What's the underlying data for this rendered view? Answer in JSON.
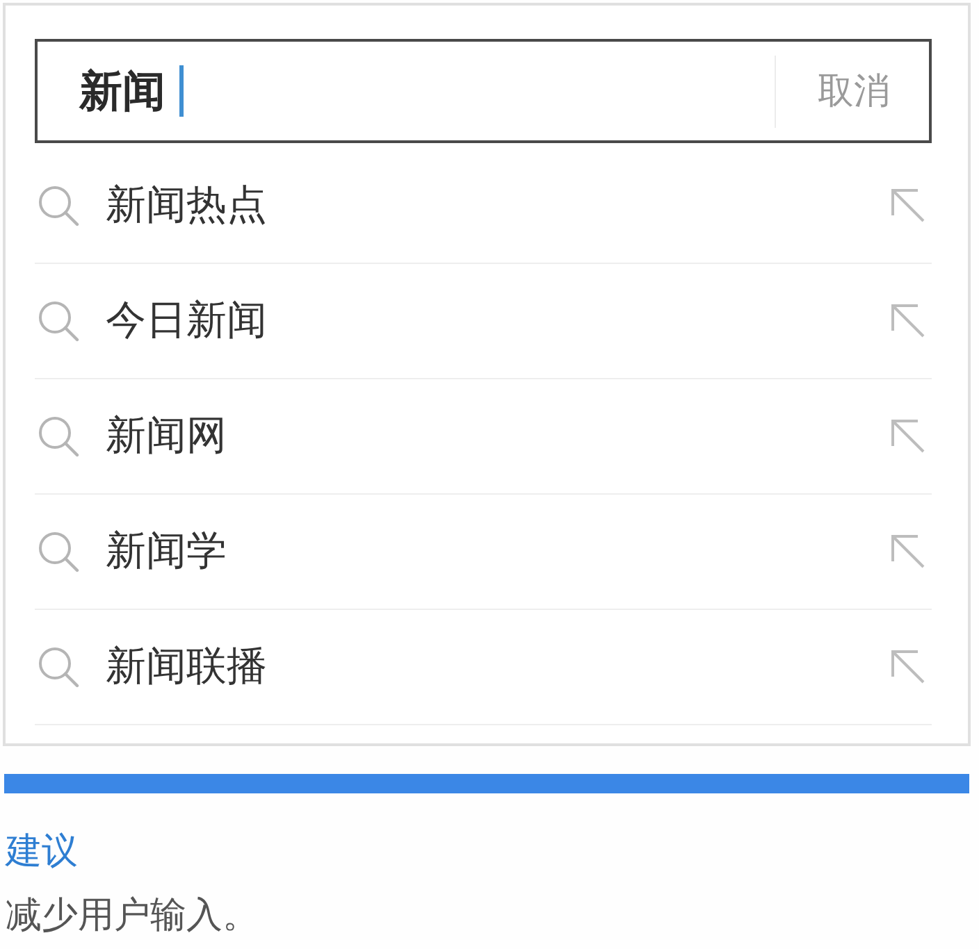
{
  "search": {
    "value": "新闻",
    "focused": true,
    "cancel_label": "取消"
  },
  "suggestions": [
    {
      "text": "新闻热点"
    },
    {
      "text": "今日新闻"
    },
    {
      "text": "新闻网"
    },
    {
      "text": "新闻学"
    },
    {
      "text": "新闻联播"
    }
  ],
  "tip": {
    "heading": "建议",
    "text": "减少用户输入。"
  }
}
